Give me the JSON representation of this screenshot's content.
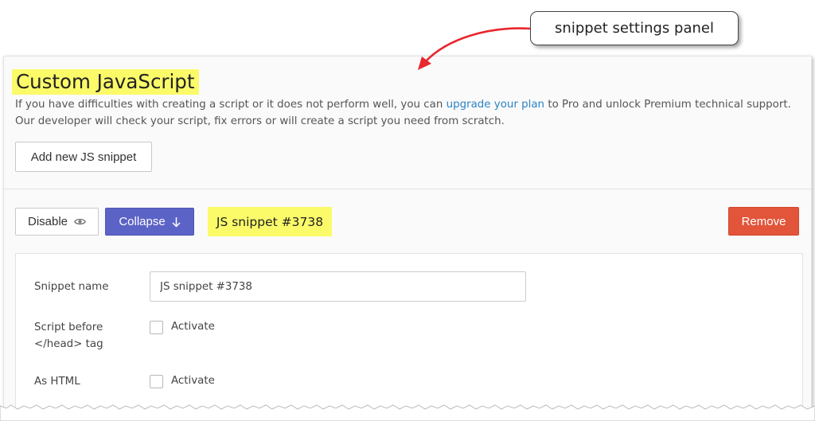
{
  "annotation": {
    "callout_text": "snippet settings panel",
    "arrow_color": "#e8262d"
  },
  "header": {
    "title": "Custom JavaScript",
    "description_before_link": "If you have difficulties with creating a script or it does not perform well, you can ",
    "link_text": "upgrade your plan",
    "description_after_link": " to Pro and unlock Premium technical support. Our developer will check your script, fix errors or will create a script you need from scratch.",
    "add_button_label": "Add new JS snippet"
  },
  "snippet_toolbar": {
    "disable_label": "Disable",
    "collapse_label": "Collapse",
    "snippet_title": "JS snippet #3738",
    "remove_label": "Remove"
  },
  "settings": {
    "name_label": "Snippet name",
    "name_value": "JS snippet #3738",
    "script_before_label_line1": "Script before",
    "script_before_label_line2": "</head> tag",
    "script_before_checkbox_label": "Activate",
    "as_html_label": "As HTML",
    "as_html_checkbox_label": "Activate"
  },
  "colors": {
    "highlight": "#fbfb6a",
    "collapse_button": "#5c63c6",
    "remove_button": "#e2553a",
    "link": "#2a83c6"
  }
}
